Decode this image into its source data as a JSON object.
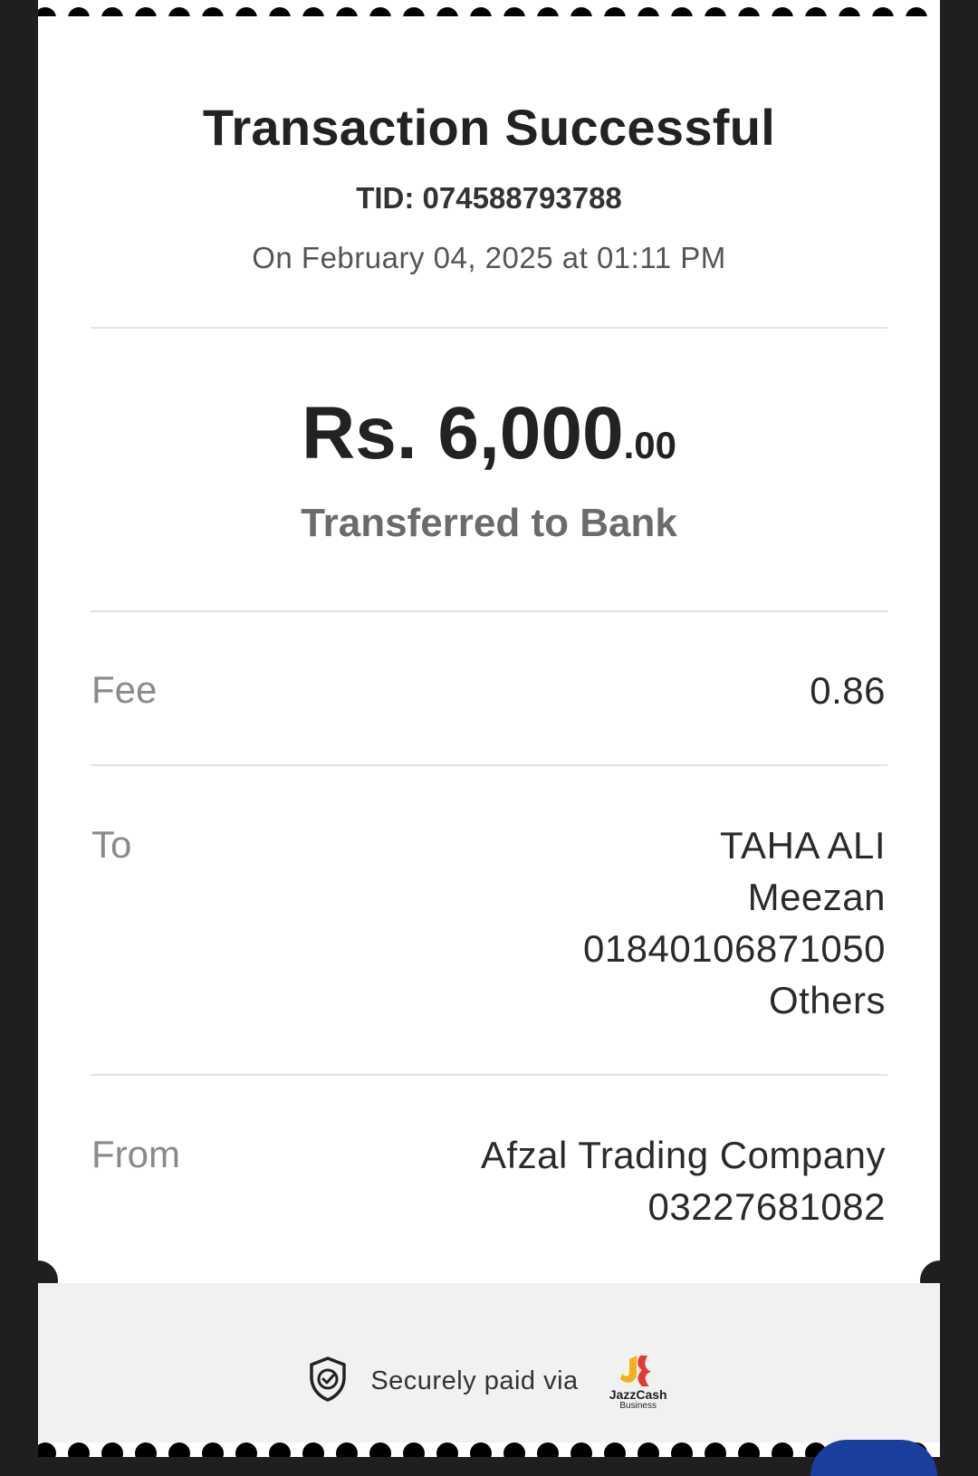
{
  "receipt": {
    "title": "Transaction Successful",
    "tid": "TID: 074588793788",
    "date": "On February 04, 2025 at 01:11 PM",
    "amount_main": "Rs. 6,000",
    "amount_cents": ".00",
    "subtitle": "Transferred to Bank",
    "fee_label": "Fee",
    "fee_value": "0.86",
    "to_label": "To",
    "to_lines": [
      "TAHA ALI",
      "Meezan",
      "01840106871050",
      "Others"
    ],
    "from_label": "From",
    "from_lines": [
      "Afzal Trading Company",
      "03227681082"
    ]
  },
  "footer": {
    "secure_text": "Securely paid via",
    "brand_text": "JazzCash",
    "brand_subtext": "Business",
    "shield_icon": "shield-check-icon",
    "brand_colors": [
      "#f5b11a",
      "#e53935"
    ]
  },
  "colors": {
    "background": "#1f1f1f",
    "fab": "#1a3e9e"
  }
}
